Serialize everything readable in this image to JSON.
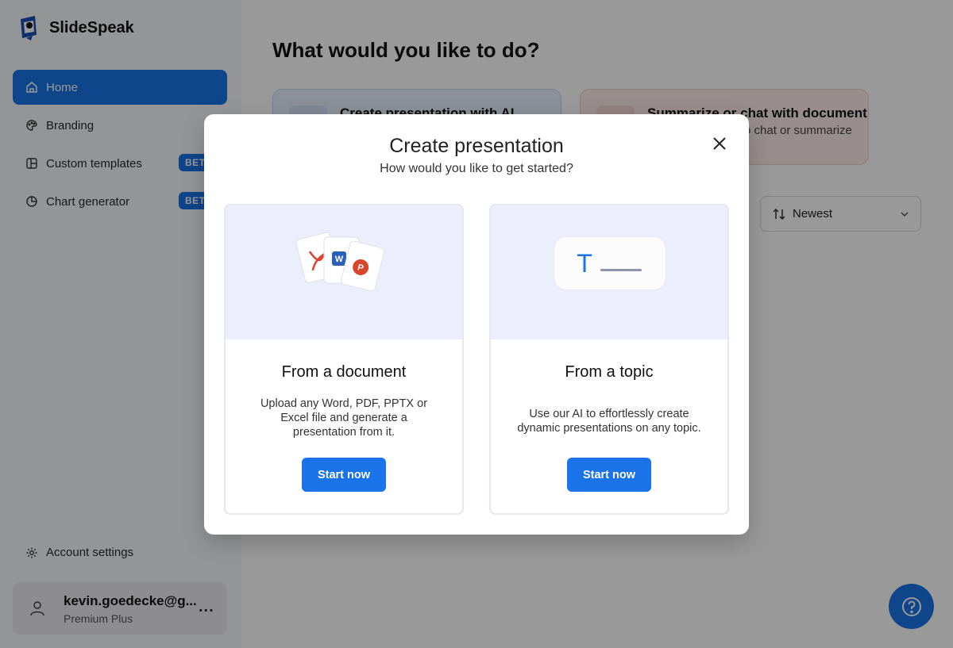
{
  "brand": {
    "name": "SlideSpeak"
  },
  "sidebar": {
    "items": [
      {
        "label": "Home",
        "icon": "home-icon",
        "active": true
      },
      {
        "label": "Branding",
        "icon": "palette-icon"
      },
      {
        "label": "Custom templates",
        "icon": "template-icon",
        "badge": "BETA"
      },
      {
        "label": "Chart generator",
        "icon": "pie-chart-icon",
        "badge": "BETA"
      }
    ],
    "account_settings": "Account settings",
    "user": {
      "email": "kevin.goedecke@g...",
      "plan": "Premium Plus",
      "more": "..."
    }
  },
  "main": {
    "title": "What would you like to do?",
    "cards": [
      {
        "title": "Create presentation with AI",
        "subtitle": ""
      },
      {
        "title": "Summarize or chat with document",
        "subtitle": "o chat or summarize"
      }
    ],
    "sort": {
      "label": "Newest"
    }
  },
  "modal": {
    "title": "Create presentation",
    "subtitle": "How would you like to get started?",
    "options": [
      {
        "title": "From a document",
        "description": "Upload any Word, PDF, PPTX or Excel file and generate a presentation from it.",
        "button": "Start now"
      },
      {
        "title": "From a topic",
        "description": "Use our AI to effortlessly create dynamic presentations on any topic.",
        "button": "Start now"
      }
    ],
    "topic_letter": "T"
  },
  "colors": {
    "accent": "#1a73e8",
    "overlay": "rgba(0,0,0,0.40)",
    "illus_bg": "#eceffb"
  }
}
